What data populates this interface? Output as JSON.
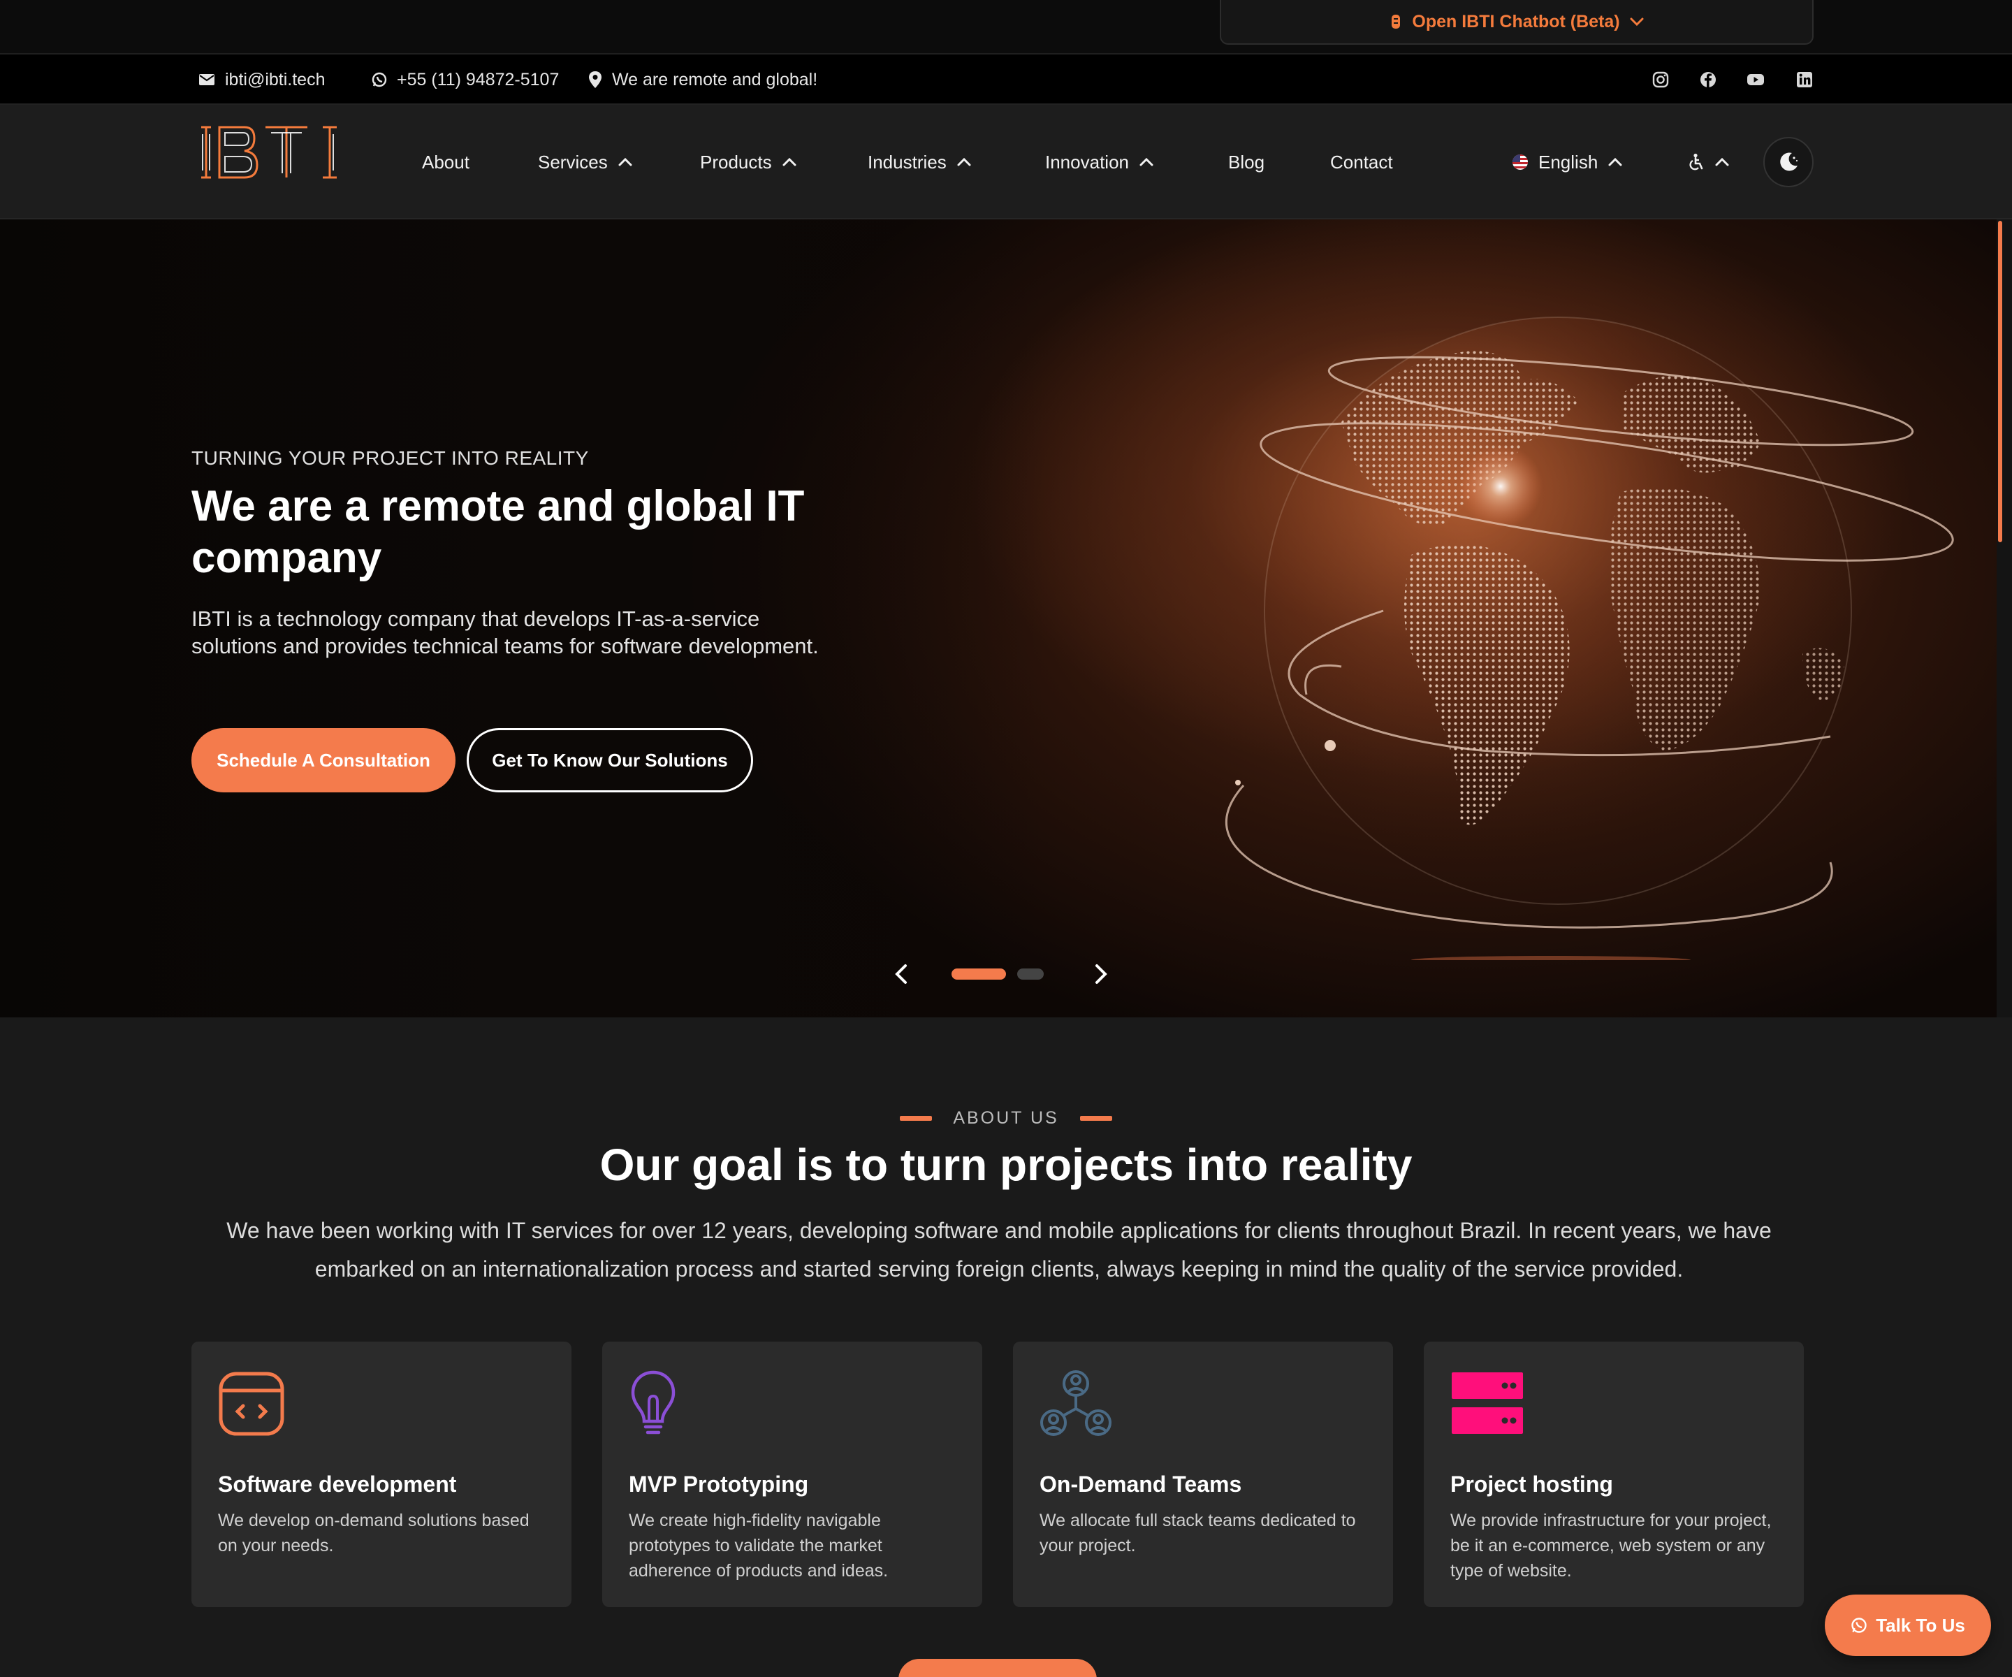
{
  "chatbot": {
    "label": "Open IBTI Chatbot (Beta)"
  },
  "contact": {
    "email": "ibti@ibti.tech",
    "phone": "+55 (11) 94872-5107",
    "location": "We are remote and global!"
  },
  "social": [
    "instagram-icon",
    "facebook-icon",
    "youtube-icon",
    "linkedin-icon"
  ],
  "nav": {
    "logo_text": "IBTI",
    "items": [
      {
        "label": "About"
      },
      {
        "label": "Services"
      },
      {
        "label": "Products"
      },
      {
        "label": "Industries"
      },
      {
        "label": "Innovation"
      },
      {
        "label": "Blog"
      },
      {
        "label": "Contact"
      }
    ],
    "language": "English"
  },
  "hero": {
    "eyebrow": "TURNING YOUR PROJECT INTO REALITY",
    "title": "We are a remote and global IT company",
    "description": "IBTI is a technology company that develops IT-as-a-service solutions and provides technical teams for software development.",
    "primary_cta": "Schedule A Consultation",
    "secondary_cta": "Get To Know Our Solutions",
    "slide_index": 1,
    "slide_count": 2
  },
  "about": {
    "eyebrow": "ABOUT US",
    "title": "Our goal is to turn projects into reality",
    "description": "We have been working with IT services for over 12 years, developing software and mobile applications for clients throughout Brazil. In recent years, we have embarked on an internationalization process and started serving foreign clients, always keeping in mind the quality of the service provided.",
    "cards": [
      {
        "title": "Software development",
        "description": "We develop on-demand solutions based on your needs.",
        "icon": "code-window-icon"
      },
      {
        "title": "MVP Prototyping",
        "description": "We create high-fidelity navigable prototypes to validate the market adherence of products and ideas.",
        "icon": "lightbulb-icon"
      },
      {
        "title": "On-Demand Teams",
        "description": "We allocate full stack teams dedicated to your project.",
        "icon": "team-icon"
      },
      {
        "title": "Project hosting",
        "description": "We provide infrastructure for your project, be it an e-commerce, web system or any type of website.",
        "icon": "server-icon"
      }
    ]
  },
  "talk": {
    "label": "Talk To Us"
  },
  "colors": {
    "accent": "#f47b4c",
    "background": "#1a1a1a",
    "card": "#2b2b2b"
  }
}
